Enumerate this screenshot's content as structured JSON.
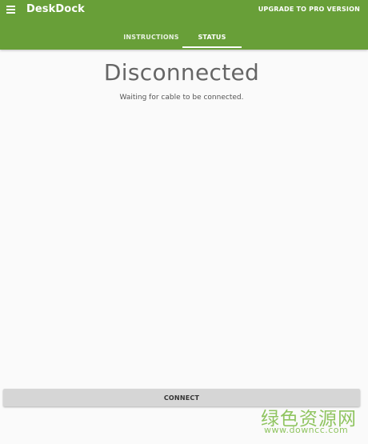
{
  "app_bar": {
    "title": "DeskDock",
    "menu_icon": "hamburger-menu-icon",
    "upgrade_label": "UPGRADE TO PRO VERSION",
    "background_color": "#689f38"
  },
  "tabs": [
    {
      "label": "INSTRUCTIONS",
      "selected": false
    },
    {
      "label": "STATUS",
      "selected": true
    }
  ],
  "status": {
    "title": "Disconnected",
    "message": "Waiting for cable to be connected."
  },
  "connect_label": "CONNECT",
  "watermark": {
    "text": "绿色资源网",
    "url": "www.downcc.com"
  }
}
